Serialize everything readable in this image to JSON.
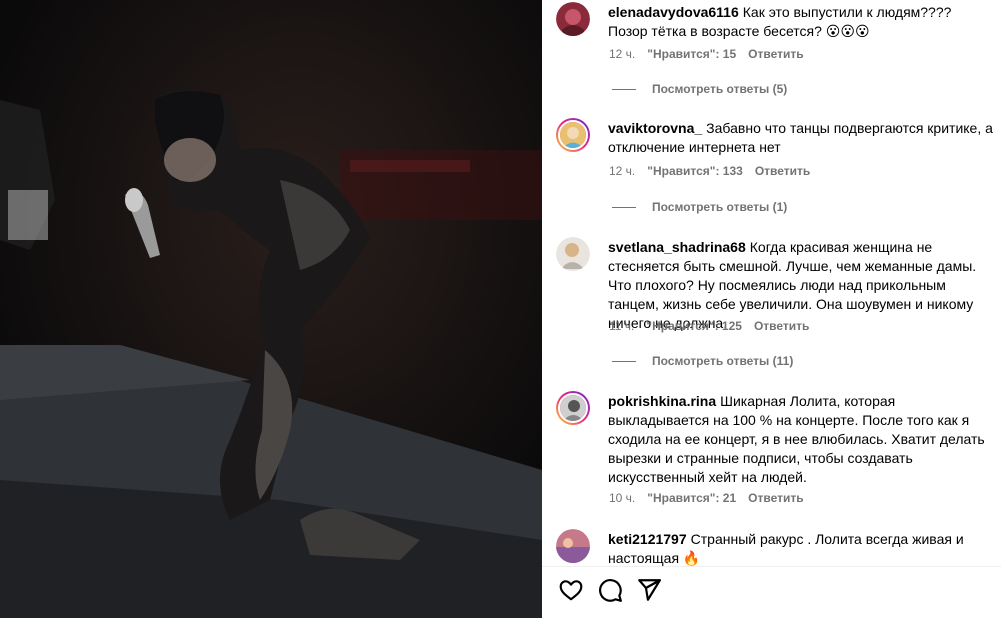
{
  "comments": [
    {
      "username": "elenadavydova6116",
      "text": "Как это выпустили к людям???? Позор тётка в возрасте бесется? 😮😮😮",
      "time": "12 ч.",
      "likes": "\"Нравится\": 15",
      "reply": "Ответить",
      "view_replies": "Посмотреть ответы (5)"
    },
    {
      "username": "vaviktorovna_",
      "text": "Забавно что танцы подвергаются критике, а отключение интернета нет",
      "time": "12 ч.",
      "likes": "\"Нравится\": 133",
      "reply": "Ответить",
      "view_replies": "Посмотреть ответы (1)"
    },
    {
      "username": "svetlana_shadrina68",
      "text": "Когда красивая женщина не стесняется быть смешной. Лучше, чем жеманные дамы. Что плохого? Ну посмеялись люди над прикольным танцем, жизнь себе увеличили. Она шоувумен и никому ничего не должна.",
      "time": "11 ч.",
      "likes": "\"Нравится\": 125",
      "reply": "Ответить",
      "view_replies": "Посмотреть ответы (11)"
    },
    {
      "username": "pokrishkina.rina",
      "text": "Шикарная Лолита, которая выкладывается на 100 % на концерте. После того как я сходила на ее концерт, я в нее влюбилась. Хватит делать вырезки и странные подписи, чтобы создавать искусственный хейт на людей.",
      "time": "10 ч.",
      "likes": "\"Нравится\": 21",
      "reply": "Ответить"
    },
    {
      "username": "keti2121797",
      "text": "Странный ракурс . Лолита всегда живая и настоящая 🔥"
    }
  ],
  "actions": {
    "like_icon": "heart-icon",
    "comment_icon": "comment-icon",
    "share_icon": "share-icon"
  },
  "colors": {
    "secondary_text": "#737373",
    "story_ring": "#ee2a7b"
  }
}
